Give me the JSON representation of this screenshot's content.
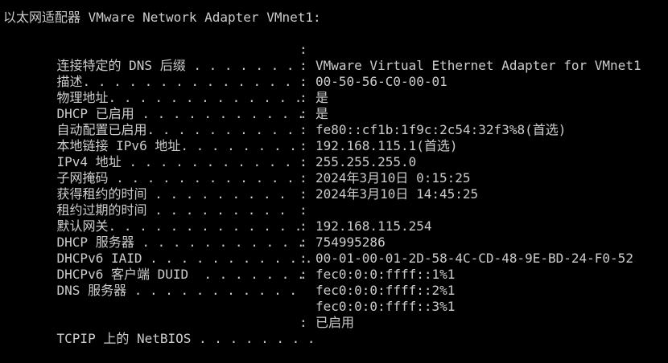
{
  "window": {
    "header": "以太网适配器 VMware Network Adapter VMnet1:"
  },
  "rows": [
    {
      "label": "连接特定的 DNS 后缀",
      "dots": " . . . . . . .",
      "sep": ":",
      "value": ""
    },
    {
      "label": "描述",
      "dots": ". . . . . . . . . . . . . . .",
      "sep": ":",
      "value": "VMware Virtual Ethernet Adapter for VMnet1"
    },
    {
      "label": "物理地址",
      "dots": ". . . . . . . . . . . . .",
      "sep": ":",
      "value": "00-50-56-C0-00-01"
    },
    {
      "label": "DHCP 已启用",
      "dots": " . . . . . . . . . . .",
      "sep": ":",
      "value": "是"
    },
    {
      "label": "自动配置已启用",
      "dots": ". . . . . . . . . .",
      "sep": ":",
      "value": "是"
    },
    {
      "label": "本地链接 IPv6 地址",
      "dots": ". . . . . . . .",
      "sep": ":",
      "value": "fe80::cf1b:1f9c:2c54:32f3%8(首选)"
    },
    {
      "label": "IPv4 地址",
      "dots": " . . . . . . . . . . . .",
      "sep": ":",
      "value": "192.168.115.1(首选)"
    },
    {
      "label": "子网掩码",
      "dots": " . . . . . . . . . . . .",
      "sep": ":",
      "value": "255.255.255.0"
    },
    {
      "label": "获得租约的时间",
      "dots": " . . . . . . . . .",
      "sep": ":",
      "value": "2024年3月10日 0:15:25"
    },
    {
      "label": "租约过期的时间",
      "dots": " . . . . . . . . .",
      "sep": ":",
      "value": "2024年3月10日 14:45:25"
    },
    {
      "label": "默认网关",
      "dots": ". . . . . . . . . . . . .",
      "sep": ":",
      "value": ""
    },
    {
      "label": "DHCP 服务器",
      "dots": " . . . . . . . . . . .",
      "sep": ":",
      "value": "192.168.115.254"
    },
    {
      "label": "DHCPv6 IAID",
      "dots": " . . . . . . . . . . .",
      "sep": ":",
      "value": "754995286"
    },
    {
      "label": "DHCPv6 客户端 DUID",
      "dots": "  . . . . . . .",
      "sep": ":",
      "value": "00-01-00-01-2D-58-4C-CD-48-9E-BD-24-F0-52"
    },
    {
      "label": "DNS 服务器",
      "dots": " . . . . . . . . . . .",
      "sep": ":",
      "value": "fec0:0:0:ffff::1%1"
    },
    {
      "label": "",
      "dots": "",
      "sep": "",
      "value": "fec0:0:0:ffff::2%1"
    },
    {
      "label": "",
      "dots": "",
      "sep": "",
      "value": "fec0:0:0:ffff::3%1"
    },
    {
      "label": "TCPIP 上的 NetBIOS",
      "dots": " . . . . . . . .",
      "sep": ":",
      "value": "已启用"
    }
  ]
}
